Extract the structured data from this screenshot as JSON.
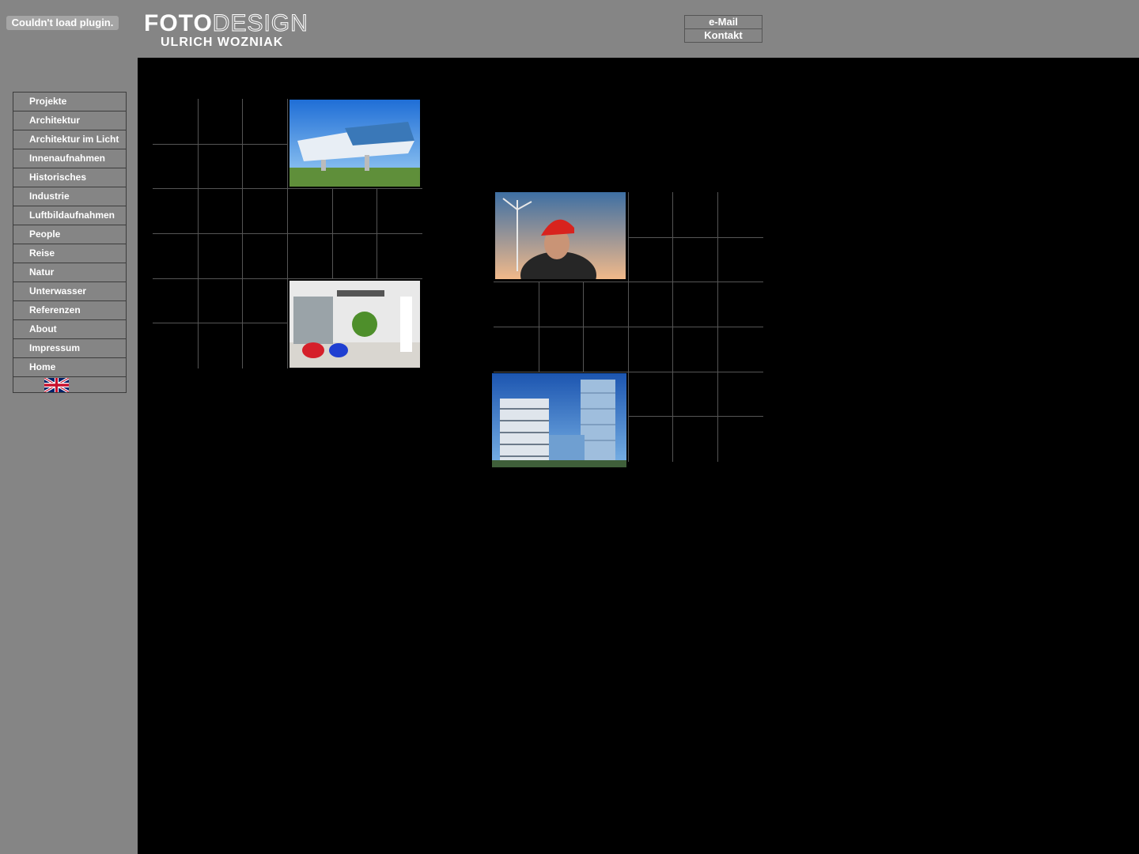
{
  "plugin": {
    "message": "Couldn't load plugin."
  },
  "logo": {
    "word_a": "FOTO",
    "word_b": "DESIGN",
    "name": "ULRICH WOZNIAK"
  },
  "top_links": [
    {
      "label": "e-Mail"
    },
    {
      "label": "Kontakt"
    }
  ],
  "nav": {
    "items": [
      {
        "label": "Projekte"
      },
      {
        "label": "Architektur"
      },
      {
        "label": "Architektur im Licht"
      },
      {
        "label": "Innenaufnahmen"
      },
      {
        "label": "Historisches"
      },
      {
        "label": "Industrie"
      },
      {
        "label": "Luftbildaufnahmen"
      },
      {
        "label": "People"
      },
      {
        "label": "Reise"
      },
      {
        "label": "Natur"
      },
      {
        "label": "Unterwasser"
      },
      {
        "label": "Referenzen"
      },
      {
        "label": "About"
      },
      {
        "label": "Impressum"
      },
      {
        "label": "Home"
      }
    ],
    "language_icon": "uk-flag-icon"
  },
  "colors": {
    "sidebar_bg": "#858585",
    "main_bg": "#000000",
    "text": "#ffffff",
    "grid_line": "#555555"
  }
}
